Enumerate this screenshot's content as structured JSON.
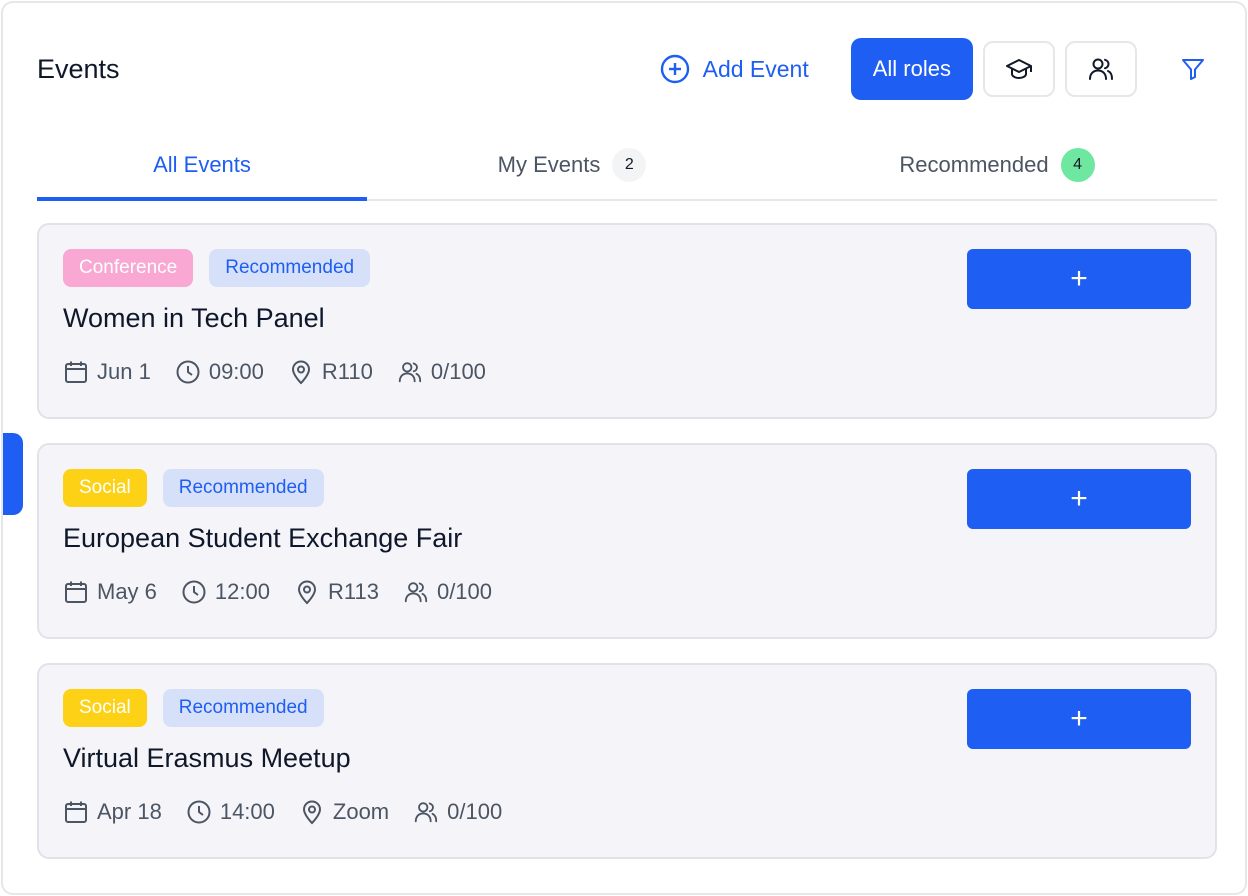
{
  "header": {
    "title": "Events",
    "add_event_label": "Add Event",
    "all_roles_label": "All roles",
    "student_icon": "graduation-cap-icon",
    "people_icon": "users-icon",
    "filter_icon": "filter-icon"
  },
  "tabs": [
    {
      "label": "All Events",
      "badge": "",
      "active": true
    },
    {
      "label": "My Events",
      "badge": "2",
      "active": false
    },
    {
      "label": "Recommended",
      "badge": "4",
      "active": false
    }
  ],
  "events": [
    {
      "category": "Conference",
      "recommended_label": "Recommended",
      "title": "Women in Tech Panel",
      "date": "Jun 1",
      "time": "09:00",
      "location": "R110",
      "capacity": "0/100",
      "join_label": "+"
    },
    {
      "category": "Social",
      "recommended_label": "Recommended",
      "title": "European Student Exchange Fair",
      "date": "May 6",
      "time": "12:00",
      "location": "R113",
      "capacity": "0/100",
      "join_label": "+"
    },
    {
      "category": "Social",
      "recommended_label": "Recommended",
      "title": "Virtual Erasmus Meetup",
      "date": "Apr 18",
      "time": "14:00",
      "location": "Zoom",
      "capacity": "0/100",
      "join_label": "+"
    }
  ],
  "colors": {
    "accent": "#1f5ef2",
    "conference_tag": "#f9a8d4",
    "social_tag": "#fcd116",
    "recommended_tag": "#d6e1f9",
    "recommended_count_badge": "#6ee7a0"
  }
}
